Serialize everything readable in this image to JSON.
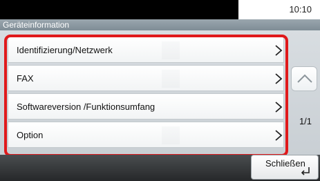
{
  "status": {
    "time": "10:10"
  },
  "screen": {
    "title": "Geräteinformation"
  },
  "menu": {
    "items": [
      {
        "label": "Identifizierung/Netzwerk"
      },
      {
        "label": "FAX"
      },
      {
        "label": "Softwareversion /Funktionsumfang"
      },
      {
        "label": "Option"
      }
    ]
  },
  "pager": {
    "indicator": "1/1"
  },
  "footer": {
    "close_label": "Schließen"
  },
  "colors": {
    "focus_outline": "#e0191b",
    "title_bar": "#8a979f",
    "bottom_bar": "#2f3133"
  },
  "icons": {
    "row_chevron": "chevron-right-icon",
    "scroll_up": "chevron-up-icon",
    "scroll_down": "chevron-down-icon",
    "enter": "enter-key-icon"
  }
}
